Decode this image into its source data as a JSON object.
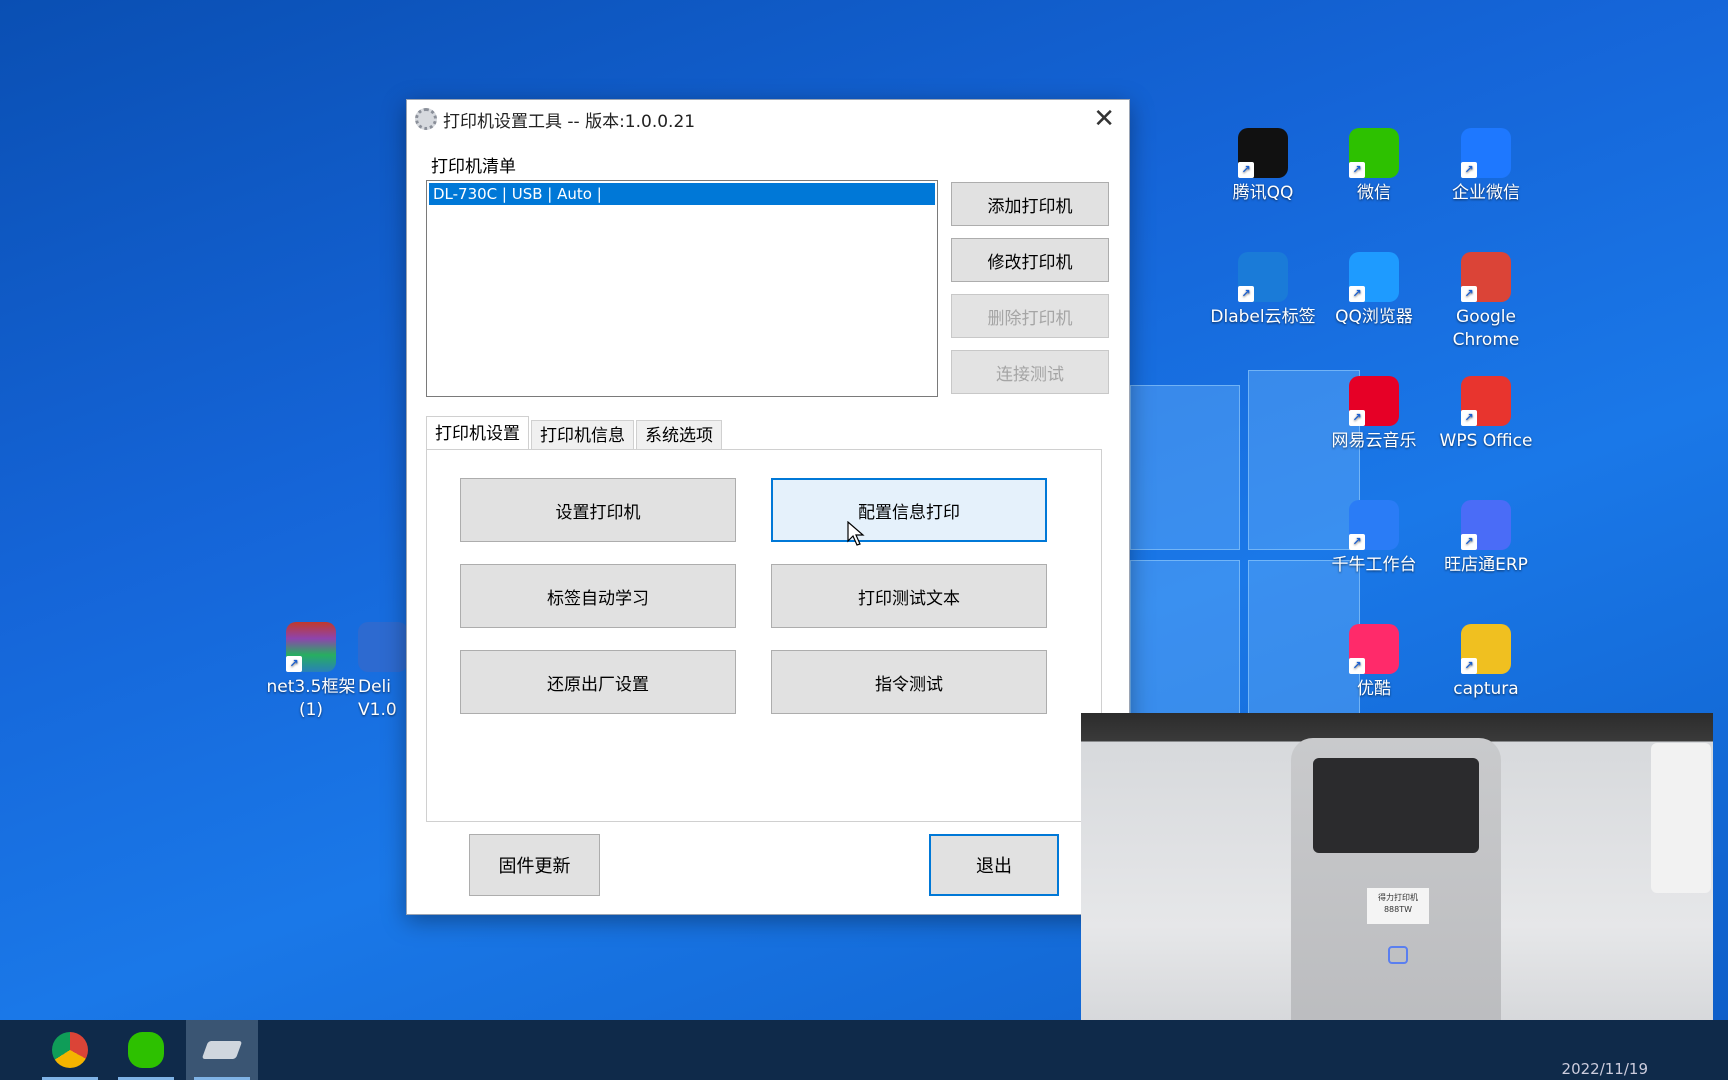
{
  "desktop": {
    "left_icons": [
      {
        "label_line1": "net3.5框架",
        "label_line2": "(1)",
        "icon": "winrar-icon"
      },
      {
        "label_line1": "Deli",
        "label_line2": "V1.0",
        "icon": "deli-app-icon"
      }
    ],
    "right_icons": [
      {
        "label": "腾讯QQ",
        "icon": "qq-icon",
        "color": "#111111"
      },
      {
        "label": "微信",
        "icon": "wechat-icon",
        "color": "#2dc100"
      },
      {
        "label": "企业微信",
        "icon": "wecom-icon",
        "color": "#1e78ff"
      },
      {
        "label": "Dlabel云标签",
        "icon": "dlabel-icon",
        "color": "#1a7bd8"
      },
      {
        "label": "QQ浏览器",
        "icon": "qq-browser-icon",
        "color": "#1e9bff"
      },
      {
        "label": "Google Chrome",
        "icon": "chrome-icon",
        "color": "#db4437"
      },
      {
        "label": "网易云音乐",
        "icon": "netease-music-icon",
        "color": "#e60026"
      },
      {
        "label": "WPS Office",
        "icon": "wps-icon",
        "color": "#e8342e"
      },
      {
        "label": "千牛工作台",
        "icon": "qianniu-icon",
        "color": "#2a7cf6"
      },
      {
        "label": "旺店通ERP",
        "icon": "wangdiantong-icon",
        "color": "#4a6cf7"
      },
      {
        "label": "优酷",
        "icon": "youku-icon",
        "color": "#ff2a6a"
      },
      {
        "label": "captura",
        "icon": "captura-icon",
        "color": "#f0c020"
      }
    ]
  },
  "dialog": {
    "title": "打印机设置工具 -- 版本:1.0.0.21",
    "list_label": "打印机清单",
    "printers": [
      "DL-730C | USB | Auto |"
    ],
    "side_buttons": {
      "add": "添加打印机",
      "edit": "修改打印机",
      "delete": "删除打印机",
      "connect_test": "连接测试"
    },
    "tabs": [
      "打印机设置",
      "打印机信息",
      "系统选项"
    ],
    "actions": {
      "setup_printer": "设置打印机",
      "config_print": "配置信息打印",
      "label_learn": "标签自动学习",
      "print_test_text": "打印测试文本",
      "factory_reset": "还原出厂设置",
      "command_test": "指令测试"
    },
    "firmware_update": "固件更新",
    "exit": "退出"
  },
  "webcam": {
    "printer_label_line1": "得力打印机",
    "printer_label_line2": "888TW"
  },
  "taskbar": {
    "clock_partial": "2022/11/19",
    "accent": "#0078d7"
  }
}
